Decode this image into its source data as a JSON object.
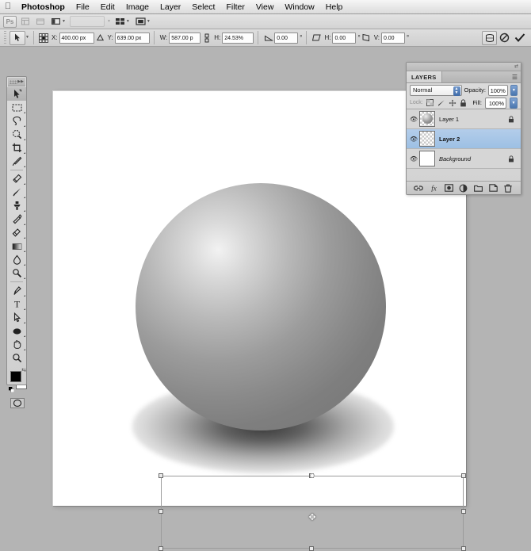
{
  "menubar": {
    "apple_icon": "apple-logo",
    "items": [
      {
        "label": "Photoshop",
        "bold": true
      },
      {
        "label": "File"
      },
      {
        "label": "Edit"
      },
      {
        "label": "Image"
      },
      {
        "label": "Layer"
      },
      {
        "label": "Select"
      },
      {
        "label": "Filter"
      },
      {
        "label": "View"
      },
      {
        "label": "Window"
      },
      {
        "label": "Help"
      }
    ]
  },
  "appbar": {
    "ps_badge": "Ps",
    "bridge_icon": "bridge-icon",
    "mini_bridge_icon": "mini-bridge-icon",
    "view_extras_icon": "view-extras-icon",
    "zoom_level": "",
    "arrange_icon": "arrange-documents-icon",
    "screen_mode_icon": "screen-mode-icon"
  },
  "options_bar": {
    "tool_preset_icon": "move-tool-preset-icon",
    "reference_point_icon": "reference-point-icon",
    "x_label": "X:",
    "x_value": "400.00 px",
    "delta_icon": "delta-triangle-icon",
    "y_label": "Y:",
    "y_value": "639.00 px",
    "w_label": "W:",
    "w_value": "587.00 p",
    "link_icon": "link-wh-icon",
    "h_label": "H:",
    "h_value": "24.53%",
    "angle_icon": "rotate-angle-icon",
    "angle_value": "0.00",
    "angle_unit": "°",
    "skew_h_label": "H:",
    "skew_h_value": "0.00",
    "skew_h_unit": "°",
    "skew_v_label": "V:",
    "skew_v_value": "0.00",
    "skew_v_unit": "°",
    "warp_button_icon": "warp-mode-icon",
    "cancel_button_icon": "cancel-transform-icon",
    "commit_button_icon": "commit-transform-icon"
  },
  "toolbox": {
    "collapse_icon": "collapse-arrows-icon",
    "tools": [
      {
        "name": "move-tool",
        "icon": "move-arrow-icon",
        "selected": true,
        "has_flyout": false
      },
      {
        "name": "marquee-tool",
        "icon": "rectangular-marquee-icon",
        "has_flyout": true
      },
      {
        "name": "lasso-tool",
        "icon": "lasso-icon",
        "has_flyout": true
      },
      {
        "name": "quick-selection-tool",
        "icon": "quick-selection-icon",
        "has_flyout": true
      },
      {
        "name": "crop-tool",
        "icon": "crop-icon",
        "has_flyout": true
      },
      {
        "name": "eyedropper-tool",
        "icon": "eyedropper-icon",
        "has_flyout": true
      },
      {
        "name": "healing-brush-tool",
        "icon": "healing-brush-icon",
        "has_flyout": true
      },
      {
        "name": "brush-tool",
        "icon": "paintbrush-icon",
        "has_flyout": true
      },
      {
        "name": "clone-stamp-tool",
        "icon": "clone-stamp-icon",
        "has_flyout": true
      },
      {
        "name": "history-brush-tool",
        "icon": "history-brush-icon",
        "has_flyout": true
      },
      {
        "name": "eraser-tool",
        "icon": "eraser-icon",
        "has_flyout": true
      },
      {
        "name": "gradient-tool",
        "icon": "gradient-icon",
        "has_flyout": true
      },
      {
        "name": "blur-tool",
        "icon": "blur-drop-icon",
        "has_flyout": true
      },
      {
        "name": "dodge-tool",
        "icon": "dodge-icon",
        "has_flyout": true
      },
      {
        "name": "pen-tool",
        "icon": "pen-icon",
        "has_flyout": true
      },
      {
        "name": "type-tool",
        "icon": "type-T-icon",
        "has_flyout": true
      },
      {
        "name": "path-selection-tool",
        "icon": "path-selection-arrow-icon",
        "has_flyout": true
      },
      {
        "name": "shape-tool",
        "icon": "ellipse-shape-icon",
        "has_flyout": true
      },
      {
        "name": "hand-tool",
        "icon": "hand-icon",
        "has_flyout": true
      },
      {
        "name": "zoom-tool",
        "icon": "magnifier-icon",
        "has_flyout": false
      }
    ],
    "foreground_color": "#000000",
    "background_color": "#ffffff",
    "default_colors_icon": "default-colors-icon",
    "swap_colors_icon": "swap-colors-icon",
    "quick_mask_icon": "quick-mask-icon"
  },
  "document": {
    "canvas_background": "#ffffff",
    "sphere_name": "gray-sphere-object",
    "shadow_name": "ellipse-drop-shadow",
    "transform_box": {
      "name": "free-transform-bounding-box",
      "handles": [
        "top-left",
        "top-center",
        "top-right",
        "middle-left",
        "middle-right",
        "bottom-left",
        "bottom-center",
        "bottom-right"
      ],
      "reference_point": "center-reference-point",
      "cursor_icon": "move-crosshair-cursor"
    }
  },
  "layers_panel": {
    "tab_label": "LAYERS",
    "panel_menu_icon": "panel-menu-icon",
    "collapse_icon": "collapse-arrows-icon",
    "blend_mode": "Normal",
    "blend_mode_stepper_icon": "stepper-arrows-icon",
    "opacity_label": "Opacity:",
    "opacity_value": "100%",
    "opacity_arrow_icon": "dropdown-arrow-icon",
    "lock_label": "Lock:",
    "lock_icons": [
      {
        "name": "lock-transparent-pixels-icon"
      },
      {
        "name": "lock-image-pixels-icon"
      },
      {
        "name": "lock-position-icon"
      },
      {
        "name": "lock-all-icon"
      }
    ],
    "fill_label": "Fill:",
    "fill_value": "100%",
    "fill_arrow_icon": "dropdown-arrow-icon",
    "layers": [
      {
        "name": "Layer 1",
        "visible": true,
        "selected": false,
        "locked": true,
        "thumb": "sphere",
        "italic": false
      },
      {
        "name": "Layer 2",
        "visible": true,
        "selected": true,
        "locked": false,
        "thumb": "checker",
        "italic": false
      },
      {
        "name": "Background",
        "visible": true,
        "selected": false,
        "locked": true,
        "thumb": "white",
        "italic": true
      }
    ],
    "footer_buttons": [
      {
        "name": "link-layers-button",
        "icon": "link-icon"
      },
      {
        "name": "layer-style-button",
        "icon": "fx-icon"
      },
      {
        "name": "layer-mask-button",
        "icon": "mask-icon"
      },
      {
        "name": "adjustment-layer-button",
        "icon": "adjustment-circle-icon"
      },
      {
        "name": "new-group-button",
        "icon": "folder-icon"
      },
      {
        "name": "new-layer-button",
        "icon": "new-layer-icon"
      },
      {
        "name": "delete-layer-button",
        "icon": "trash-icon"
      }
    ]
  }
}
